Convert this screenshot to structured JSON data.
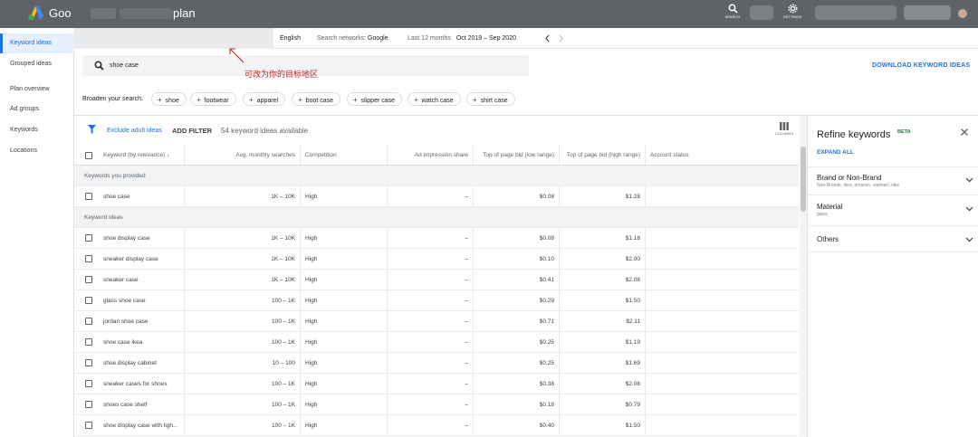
{
  "header": {
    "app_title_start": "Goo",
    "app_title_end": "plan",
    "icons": [
      {
        "name": "search-icon",
        "label": "SEARCH"
      },
      {
        "name": "settings-icon",
        "label": "SETTINGS"
      }
    ],
    "colors": {
      "bar": "#5f6368",
      "accent": "#1a73e8"
    }
  },
  "subbar": {
    "language": "English",
    "networks_label": "Search networks:",
    "networks_value": "Google",
    "date_label": "Last 12 months",
    "date_value": "Oct 2019 – Sep 2020"
  },
  "sidebar": {
    "items": [
      {
        "label": "Keyword ideas",
        "active": true
      },
      {
        "label": "Grouped ideas",
        "active": false
      },
      {
        "label": "Plan overview",
        "active": false
      },
      {
        "label": "Ad groups",
        "active": false
      },
      {
        "label": "Keywords",
        "active": false
      },
      {
        "label": "Locations",
        "active": false
      }
    ]
  },
  "search": {
    "value": "shoe case",
    "annotation": "可改为你的目标地区"
  },
  "download_label": "DOWNLOAD KEYWORD IDEAS",
  "broaden": {
    "label": "Broaden your search:",
    "chips": [
      "shoe",
      "footwear",
      "apparel",
      "boot case",
      "slipper case",
      "watch case",
      "shirt case"
    ]
  },
  "toolbar": {
    "exclude_adult": "Exclude adult ideas",
    "add_filter": "ADD FILTER",
    "count": "54 keyword ideas available",
    "columns_label": "COLUMNS"
  },
  "table": {
    "headers": [
      "Keyword (by relevance)",
      "Avg. monthly searches",
      "Competition",
      "Ad impression share",
      "Top of page bid (low range)",
      "Top of page bid (high range)",
      "Account status"
    ],
    "group_provided": "Keywords you provided",
    "provided_rows": [
      {
        "keyword": "shoe case",
        "avg": "1K – 10K",
        "competition": "High",
        "impression": "–",
        "low": "$0.08",
        "high": "$1.28"
      }
    ],
    "group_ideas": "Keyword ideas",
    "idea_rows": [
      {
        "keyword": "shoe display case",
        "avg": "1K – 10K",
        "competition": "High",
        "impression": "–",
        "low": "$0.08",
        "high": "$1.18"
      },
      {
        "keyword": "sneaker display case",
        "avg": "1K – 10K",
        "competition": "High",
        "impression": "–",
        "low": "$0.10",
        "high": "$2.00"
      },
      {
        "keyword": "sneaker case",
        "avg": "1K – 10K",
        "competition": "High",
        "impression": "–",
        "low": "$0.41",
        "high": "$2.08"
      },
      {
        "keyword": "glass shoe case",
        "avg": "100 – 1K",
        "competition": "High",
        "impression": "–",
        "low": "$0.29",
        "high": "$1.50"
      },
      {
        "keyword": "jordan shoe case",
        "avg": "100 – 1K",
        "competition": "High",
        "impression": "–",
        "low": "$0.71",
        "high": "$2.11"
      },
      {
        "keyword": "shoe case ikea",
        "avg": "100 – 1K",
        "competition": "High",
        "impression": "–",
        "low": "$0.25",
        "high": "$1.19"
      },
      {
        "keyword": "shoe display cabinet",
        "avg": "10 – 100",
        "competition": "High",
        "impression": "–",
        "low": "$0.25",
        "high": "$1.69"
      },
      {
        "keyword": "sneaker cases for shoes",
        "avg": "100 – 1K",
        "competition": "High",
        "impression": "–",
        "low": "$0.38",
        "high": "$2.08"
      },
      {
        "keyword": "shoes case shelf",
        "avg": "100 – 1K",
        "competition": "High",
        "impression": "–",
        "low": "$0.18",
        "high": "$0.79"
      },
      {
        "keyword": "shoe display case with ligh...",
        "avg": "100 – 1K",
        "competition": "High",
        "impression": "–",
        "low": "$0.40",
        "high": "$1.50"
      }
    ]
  },
  "refine": {
    "title": "Refine keywords",
    "beta": "BETA",
    "expand_all": "EXPAND ALL",
    "sections": [
      {
        "name": "Brand or Non-Brand",
        "sub": "Non-Brands, ikea, amazon, walmart, nike"
      },
      {
        "name": "Material",
        "sub": "glass"
      },
      {
        "name": "Others",
        "sub": ""
      }
    ]
  }
}
